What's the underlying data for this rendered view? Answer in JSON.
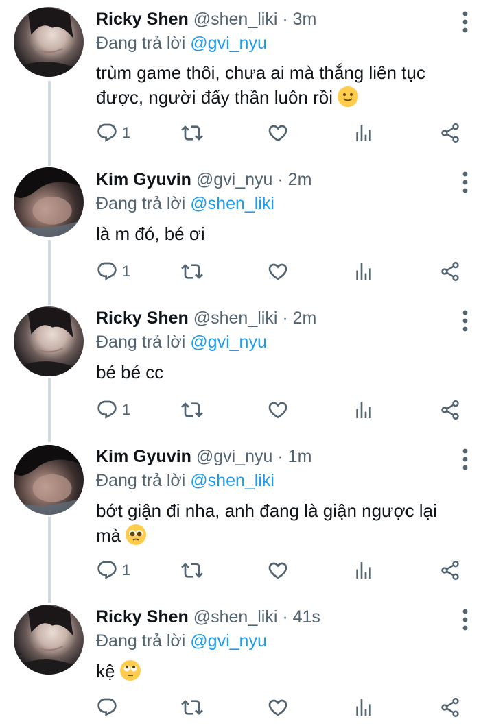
{
  "thread": {
    "tweets": [
      {
        "name": "Ricky Shen",
        "handle": "@shen_liki",
        "separator": "·",
        "time": "3m",
        "reply_prefix": "Đang trả lời",
        "reply_to": "@gvi_nyu",
        "text_line1": "trùm game thôi, chưa ai mà thắng liên tục",
        "text_line2": "được, người đấy thần luôn rồi",
        "emoji": "slightly-smiling-face",
        "reply_count": "1",
        "avatar": "ricky-avatar"
      },
      {
        "name": "Kim Gyuvin",
        "handle": "@gvi_nyu",
        "separator": "·",
        "time": "2m",
        "reply_prefix": "Đang trả lời",
        "reply_to": "@shen_liki",
        "text_line1": "là m đó, bé ơi",
        "reply_count": "1",
        "avatar": "kim-avatar"
      },
      {
        "name": "Ricky Shen",
        "handle": "@shen_liki",
        "separator": "·",
        "time": "2m",
        "reply_prefix": "Đang trả lời",
        "reply_to": "@gvi_nyu",
        "text_line1": "bé bé cc",
        "reply_count": "1",
        "avatar": "ricky-avatar"
      },
      {
        "name": "Kim Gyuvin",
        "handle": "@gvi_nyu",
        "separator": "·",
        "time": "1m",
        "reply_prefix": "Đang trả lời",
        "reply_to": "@shen_liki",
        "text_line1": "bớt giận đi nha, anh đang là giận ngược lại",
        "text_line2": "mà",
        "emoji": "pleading-face",
        "reply_count": "1",
        "avatar": "kim-avatar"
      },
      {
        "name": "Ricky Shen",
        "handle": "@shen_liki",
        "separator": "·",
        "time": "41s",
        "reply_prefix": "Đang trả lời",
        "reply_to": "@gvi_nyu",
        "text_line1": "kệ",
        "emoji": "face-with-rolling-eyes",
        "reply_count": "",
        "avatar": "ricky-avatar"
      }
    ]
  },
  "icons": {
    "reply": "reply-icon",
    "retweet": "retweet-icon",
    "like": "heart-icon",
    "analytics": "analytics-icon",
    "share": "share-icon",
    "more": "more-options-icon"
  },
  "colors": {
    "link": "#1d9bf0",
    "secondary_text": "#536471",
    "thread_line": "#cfd9de"
  }
}
